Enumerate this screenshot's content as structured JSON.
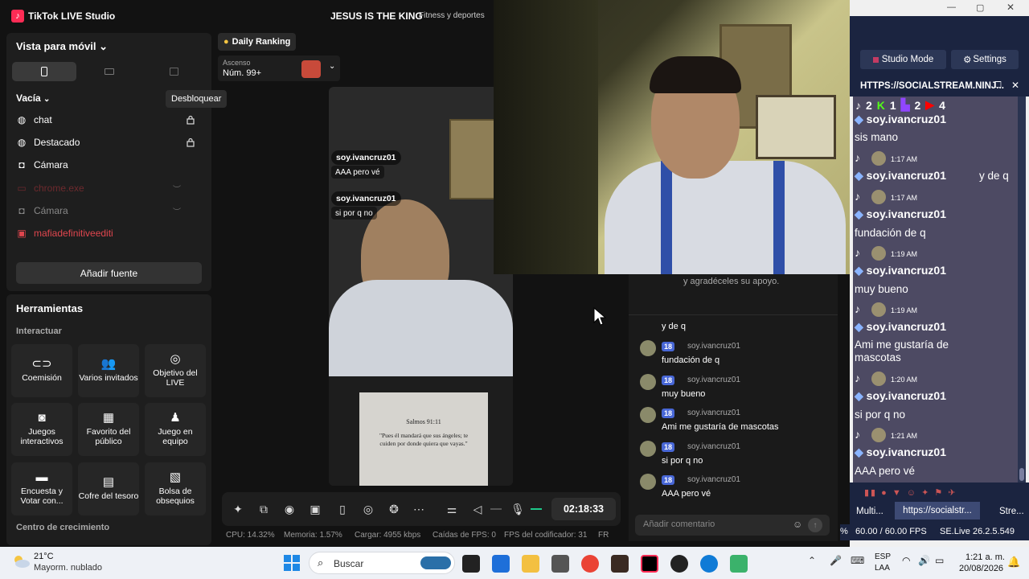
{
  "app": {
    "title": "TikTok LIVE Studio",
    "stream_title": "JESUS IS THE KING",
    "stream_category": "Fitness y deportes"
  },
  "sources": {
    "view_label": "Vista para móvil",
    "scene_label": "Vacía",
    "tooltip": "Desbloquear",
    "items": [
      {
        "label": "chat",
        "icon": "globe-icon",
        "state": "normal"
      },
      {
        "label": "Destacado",
        "icon": "globe-icon",
        "state": "normal"
      },
      {
        "label": "Cámara",
        "icon": "camera-icon",
        "state": "normal"
      },
      {
        "label": "chrome.exe",
        "icon": "window-icon",
        "state": "error"
      },
      {
        "label": "Cámara",
        "icon": "camera-icon",
        "state": "dim"
      },
      {
        "label": "mafiadefinitiveediti",
        "icon": "game-icon",
        "state": "error"
      }
    ],
    "add_source": "Añadir fuente"
  },
  "tools": {
    "title": "Herramientas",
    "section_interact": "Interactuar",
    "cards": [
      {
        "label": "Coemisión",
        "icon": "link-icon"
      },
      {
        "label": "Varios invitados",
        "icon": "users-icon"
      },
      {
        "label": "Objetivo del LIVE",
        "icon": "target-icon"
      },
      {
        "label": "Juegos interactivos",
        "icon": "gamepad-icon"
      },
      {
        "label": "Favorito del público",
        "icon": "gift-icon"
      },
      {
        "label": "Juego en equipo",
        "icon": "team-icon"
      },
      {
        "label": "Encuesta y Votar con...",
        "icon": "poll-icon"
      },
      {
        "label": "Cofre del tesoro",
        "icon": "chest-icon"
      },
      {
        "label": "Bolsa de obsequios",
        "icon": "bag-icon"
      }
    ],
    "section_growth": "Centro de crecimiento"
  },
  "ranking": {
    "label": "Daily Ranking",
    "sub_label": "Ascenso",
    "value": "Núm. 99+"
  },
  "preview": {
    "bubbles": [
      {
        "user": "soy.ivancruz01",
        "text": "AAA pero vé"
      },
      {
        "user": "soy.ivancruz01",
        "text": "si por q no"
      }
    ],
    "psalm_title": "Salmos 91:11",
    "psalm_text": "\"Pues él mandará que sus ángeles; te cuiden por donde quiera que vayas.\""
  },
  "controls": {
    "timer": "02:18:33"
  },
  "stats": {
    "cpu": "CPU:  14.32%",
    "memory": "Memoria:  1.57%",
    "upload": "Cargar:  4955 kbps",
    "fps_drops": "Caídas de FPS:  0",
    "encoder_fps": "FPS del codificador:  31",
    "fr": "FR"
  },
  "live_chat": {
    "thanks_note": "y agradéceles su apoyo.",
    "first_text": "y de q",
    "messages": [
      {
        "badge": "18",
        "user": "soy.ivancruz01",
        "text": "fundación de q"
      },
      {
        "badge": "18",
        "user": "soy.ivancruz01",
        "text": "muy bueno"
      },
      {
        "badge": "18",
        "user": "soy.ivancruz01",
        "text": "Ami me gustaría de mascotas"
      },
      {
        "badge": "18",
        "user": "soy.ivancruz01",
        "text": "si por q no"
      },
      {
        "badge": "18",
        "user": "soy.ivancruz01",
        "text": "AAA pero vé"
      }
    ],
    "comment_placeholder": "Añadir comentario"
  },
  "social_stream": {
    "studio_mode": "Studio Mode",
    "settings": "Settings",
    "url_title": "HTTPS://SOCIALSTREAM.NINJ...",
    "counts": {
      "tiktok": "2",
      "kick": "1",
      "twitch": "2",
      "youtube": "4"
    },
    "entries": [
      {
        "time": "",
        "user": "soy.ivancruz01",
        "text": "sis mano"
      },
      {
        "time": "1:17 AM",
        "user": "soy.ivancruz01",
        "text": "y de q"
      },
      {
        "time": "1:17 AM",
        "user": "soy.ivancruz01",
        "text": "fundación de q"
      },
      {
        "time": "1:19 AM",
        "user": "soy.ivancruz01",
        "text": "muy bueno"
      },
      {
        "time": "1:19 AM",
        "user": "soy.ivancruz01",
        "text": "Ami me gustaría de mascotas"
      },
      {
        "time": "1:20 AM",
        "user": "soy.ivancruz01",
        "text": "si por q no"
      },
      {
        "time": "1:21 AM",
        "user": "soy.ivancruz01",
        "text": "AAA pero vé"
      }
    ],
    "tabs": [
      "Multi...",
      "https://socialstr...",
      "Stre..."
    ],
    "fps": "60.00 / 60.00 FPS",
    "version": "SE.Live 26.2.5.549",
    "pct": "%"
  },
  "taskbar": {
    "weather_temp": "21°C",
    "weather_desc": "Mayorm. nublado",
    "search_placeholder": "Buscar",
    "lang_top": "ESP",
    "lang_bottom": "LAA",
    "time": "1:21 a. m.",
    "date": "20/08/2026"
  },
  "colors": {
    "accent": "#fe2c55",
    "error": "#e0464e",
    "badge": "#4867d6",
    "ss_bg": "#4d4a63"
  }
}
